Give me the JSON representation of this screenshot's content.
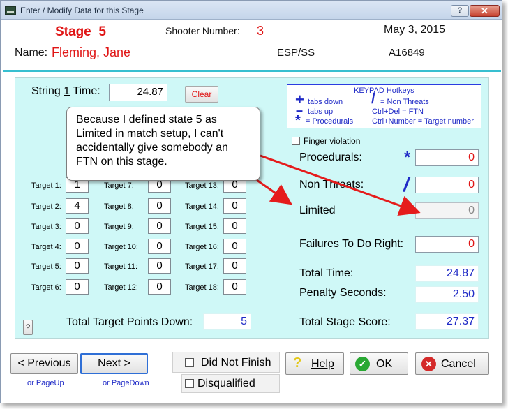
{
  "window": {
    "title": "Enter / Modify Data for this Stage",
    "help_glyph": "?",
    "close_glyph": "✕"
  },
  "header": {
    "stage_label": "Stage",
    "stage_number": "5",
    "shooter_label": "Shooter Number:",
    "shooter_number": "3",
    "date": "May  3, 2015",
    "name_label": "Name:",
    "name": "Fleming, Jane",
    "division": "ESP/SS",
    "member_id": "A16849"
  },
  "string": {
    "label_pre": "String ",
    "label_num": "1",
    "label_post": " Time:",
    "time": "24.87",
    "clear_label": "Clear"
  },
  "keypad": {
    "title": "KEYPAD Hotkeys",
    "plus_sym": "+",
    "plus_text": "tabs down",
    "minus_sym": "–",
    "minus_text": "tabs up",
    "star_sym": "*",
    "star_text": "= Procedurals",
    "slash_sym": "/",
    "slash_text": "= Non Threats",
    "ctrl_del": "Ctrl+Del = FTN",
    "ctrl_num": "Ctrl+Number = Target number"
  },
  "callout": {
    "text": "Because I defined state 5 as Limited in match setup, I can't accidentally give somebody an FTN on this stage."
  },
  "targets": [
    {
      "label": "Target 1:",
      "value": "1"
    },
    {
      "label": "Target 2:",
      "value": "4"
    },
    {
      "label": "Target 3:",
      "value": "0"
    },
    {
      "label": "Target 4:",
      "value": "0"
    },
    {
      "label": "Target 5:",
      "value": "0"
    },
    {
      "label": "Target 6:",
      "value": "0"
    },
    {
      "label": "Target 7:",
      "value": "0"
    },
    {
      "label": "Target 8:",
      "value": "0"
    },
    {
      "label": "Target 9:",
      "value": "0"
    },
    {
      "label": "Target 10:",
      "value": "0"
    },
    {
      "label": "Target 11:",
      "value": "0"
    },
    {
      "label": "Target 12:",
      "value": "0"
    },
    {
      "label": "Target 13:",
      "value": "0"
    },
    {
      "label": "Target 14:",
      "value": "0"
    },
    {
      "label": "Target 15:",
      "value": "0"
    },
    {
      "label": "Target 16:",
      "value": "0"
    },
    {
      "label": "Target 17:",
      "value": "0"
    },
    {
      "label": "Target 18:",
      "value": "0"
    }
  ],
  "penalties": {
    "finger_violation": "Finger violation",
    "procedurals_label": "Procedurals:",
    "procedurals_sym": "*",
    "procedurals_value": "0",
    "non_threats_label": "Non Threats:",
    "non_threats_sym": "/",
    "non_threats_value": "0",
    "limited_label": "Limited",
    "limited_value": "0",
    "ftdr_label": "Failures To Do Right:",
    "ftdr_value": "0"
  },
  "totals": {
    "total_time_label": "Total Time:",
    "total_time": "24.87",
    "penalty_label": "Penalty Seconds:",
    "penalty_seconds": "2.50",
    "points_down_label": "Total Target Points Down:",
    "points_down": "5",
    "stage_score_label": "Total Stage Score:",
    "stage_score": "27.37"
  },
  "footer": {
    "q_button": "?",
    "previous": "< Previous",
    "previous_hint": "or PageUp",
    "next": "Next >",
    "next_hint": "or PageDown",
    "did_not_finish": "Did Not Finish",
    "disqualified": "Disqualified",
    "help": "Help",
    "ok": "OK",
    "cancel": "Cancel"
  }
}
